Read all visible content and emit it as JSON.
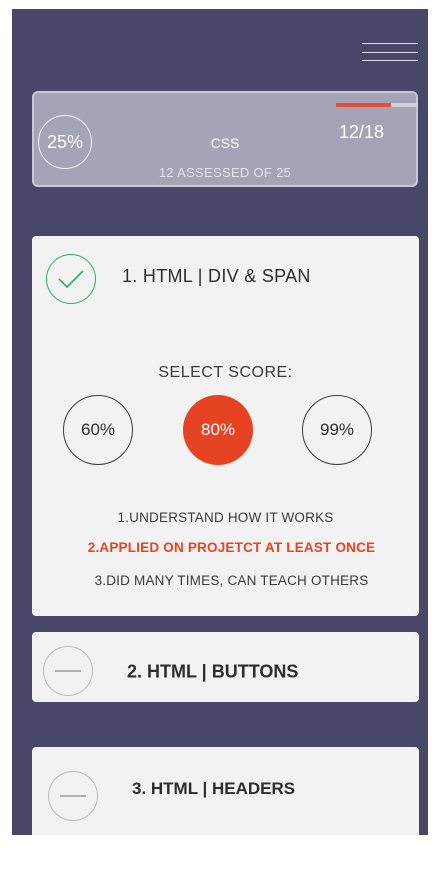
{
  "summary": {
    "percent": "25%",
    "progress_fraction": 0.667,
    "count": "12/18",
    "title": "CSS",
    "subtitle": "12 ASSESSED OF 25"
  },
  "cards": [
    {
      "title": "1. HTML | DIV & SPAN",
      "status": "completed",
      "select_label": "SELECT SCORE:",
      "scores": [
        "60%",
        "80%",
        "99%"
      ],
      "selected_score": "80%",
      "criteria": [
        "1.UNDERSTAND HOW IT WORKS",
        "2.APPLIED ON PROJETCT AT LEAST ONCE",
        "3.DID MANY TIMES, CAN TEACH OTHERS"
      ]
    },
    {
      "title": "2. HTML | BUTTONS",
      "status": "pending"
    },
    {
      "title": "3. HTML | HEADERS",
      "status": "pending"
    }
  ],
  "colors": {
    "background": "#484767",
    "accent": "#e64322",
    "success": "#2db353",
    "card": "#f2f2f2"
  },
  "icons": {
    "menu": "hamburger-menu-icon",
    "completed": "check-circle-icon",
    "pending": "minus-circle-icon"
  }
}
